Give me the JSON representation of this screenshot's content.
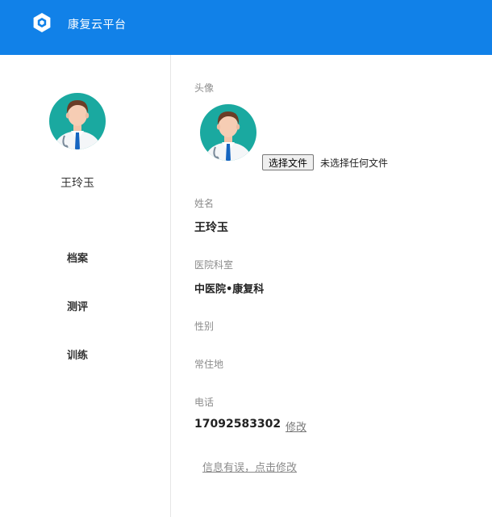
{
  "header": {
    "title": "康复云平台",
    "logo_icon": "hexagon-logo-icon",
    "bg_color": "#1181e8"
  },
  "sidebar": {
    "avatar_icon": "doctor-avatar-icon",
    "user_name": "王玲玉",
    "nav": [
      {
        "label": "档案"
      },
      {
        "label": "测评"
      },
      {
        "label": "训练"
      }
    ]
  },
  "profile": {
    "avatar_label": "头像",
    "file_button_label": "选择文件",
    "file_status": "未选择任何文件",
    "name_label": "姓名",
    "name_value": "王玲玉",
    "dept_label": "医院科室",
    "dept_value": "中医院•康复科",
    "gender_label": "性别",
    "residence_label": "常住地",
    "phone_label": "电话",
    "phone_value": "17092583302",
    "edit_label": "修改",
    "error_link": "信息有误，点击修改"
  }
}
